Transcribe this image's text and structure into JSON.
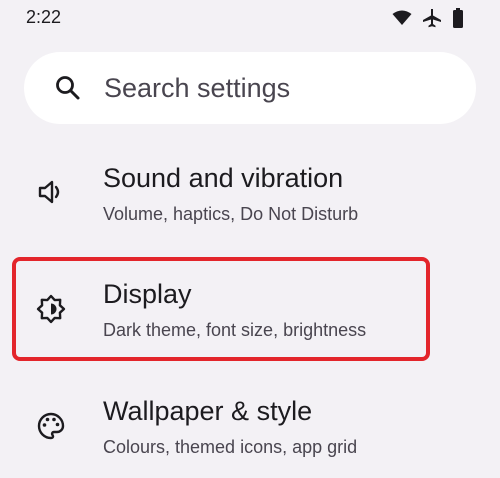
{
  "status_bar": {
    "time": "2:22",
    "icons": [
      "wifi-icon",
      "airplane-mode-icon",
      "battery-icon"
    ]
  },
  "search": {
    "placeholder": "Search settings",
    "icon": "search-icon"
  },
  "settings": [
    {
      "title": "Sound and vibration",
      "subtitle": "Volume, haptics, Do Not Disturb",
      "icon": "volume-icon"
    },
    {
      "title": "Display",
      "subtitle": "Dark theme, font size, brightness",
      "icon": "brightness-icon",
      "highlighted": true
    },
    {
      "title": "Wallpaper & style",
      "subtitle": "Colours, themed icons, app grid",
      "icon": "palette-icon"
    }
  ],
  "colors": {
    "background": "#f3f1f5",
    "highlight": "#e3252b",
    "text_primary": "#1c1b1f",
    "text_secondary": "#49454f"
  }
}
